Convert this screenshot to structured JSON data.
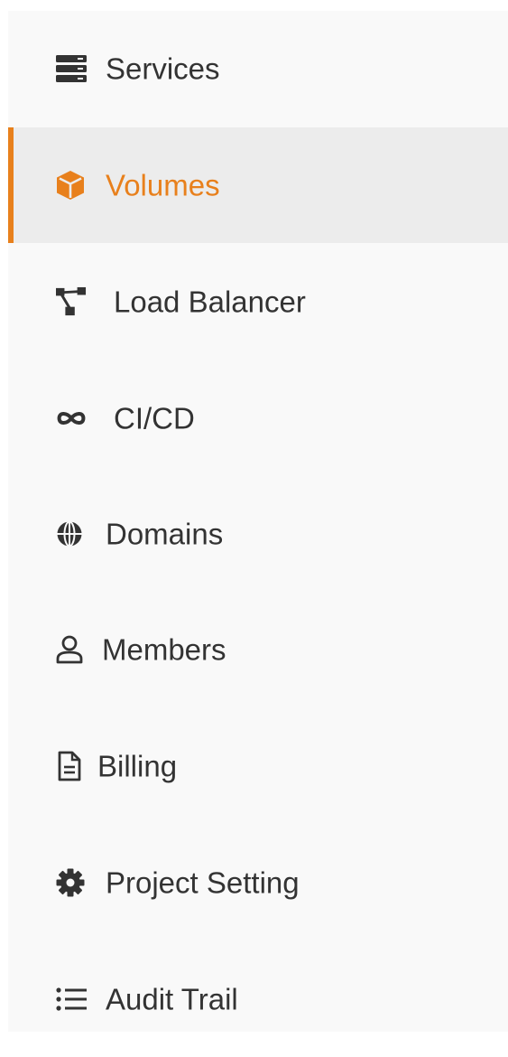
{
  "sidebar": {
    "accent_color": "#e8801c",
    "items": [
      {
        "label": "Services",
        "icon": "server-icon",
        "active": false
      },
      {
        "label": "Volumes",
        "icon": "cube-icon",
        "active": true
      },
      {
        "label": "Load Balancer",
        "icon": "network-icon",
        "active": false
      },
      {
        "label": "CI/CD",
        "icon": "infinity-icon",
        "active": false
      },
      {
        "label": "Domains",
        "icon": "globe-icon",
        "active": false
      },
      {
        "label": "Members",
        "icon": "user-icon",
        "active": false
      },
      {
        "label": "Billing",
        "icon": "document-icon",
        "active": false
      },
      {
        "label": "Project Setting",
        "icon": "gear-icon",
        "active": false
      },
      {
        "label": "Audit Trail",
        "icon": "list-icon",
        "active": false
      }
    ]
  }
}
